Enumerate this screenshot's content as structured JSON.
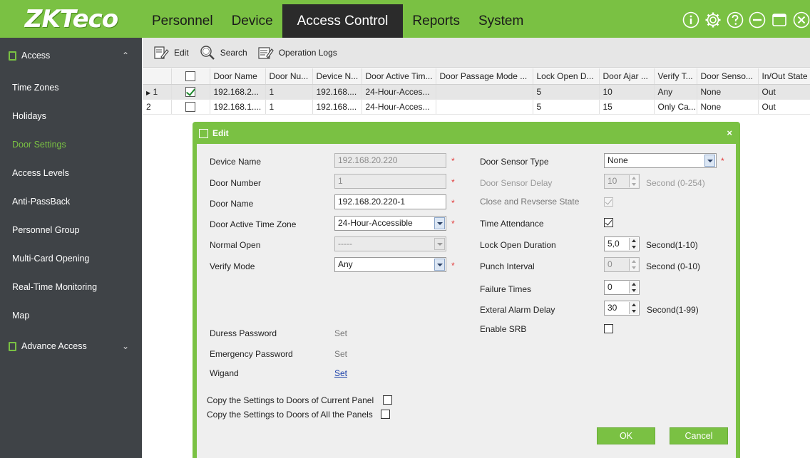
{
  "app": {
    "logo": "ZKTeco"
  },
  "nav": {
    "items": [
      {
        "label": "Personnel"
      },
      {
        "label": "Device"
      },
      {
        "label": "Access Control"
      },
      {
        "label": "Reports"
      },
      {
        "label": "System"
      }
    ],
    "active": "Access Control"
  },
  "window_icons": [
    "info-icon",
    "gear-icon",
    "help-icon",
    "minimize-icon",
    "maximize-icon",
    "close-icon"
  ],
  "sidebar": {
    "section1": "Access",
    "items": [
      "Time Zones",
      "Holidays",
      "Door Settings",
      "Access Levels",
      "Anti-PassBack",
      "Personnel Group",
      "Multi-Card Opening",
      "Real-Time Monitoring",
      "Map"
    ],
    "active": "Door Settings",
    "section2": "Advance Access"
  },
  "toolbar": {
    "edit": "Edit",
    "search": "Search",
    "operation_logs": "Operation Logs"
  },
  "grid": {
    "columns": [
      "Door Name",
      "Door Nu...",
      "Device N...",
      "Door Active Tim...",
      "Door Passage Mode ...",
      "Lock Open D...",
      "Door Ajar ...",
      "Verify T...",
      "Door Senso...",
      "In/Out State"
    ],
    "rows": [
      {
        "index": "1",
        "checked": true,
        "cells": [
          "192.168.2...",
          "1",
          "192.168....",
          "24-Hour-Acces...",
          "",
          "5",
          "10",
          "Any",
          "None",
          "Out"
        ]
      },
      {
        "index": "2",
        "checked": false,
        "cells": [
          "192.168.1....",
          "1",
          "192.168....",
          "24-Hour-Acces...",
          "",
          "5",
          "15",
          "Only Ca...",
          "None",
          "Out"
        ]
      }
    ]
  },
  "dialog": {
    "title": "Edit",
    "close": "×",
    "left": {
      "device_name": {
        "label": "Device Name",
        "value": "192.168.20.220"
      },
      "door_number": {
        "label": "Door Number",
        "value": "1"
      },
      "door_name": {
        "label": "Door Name",
        "value": "192.168.20.220-1"
      },
      "door_active_tz": {
        "label": "Door Active Time Zone",
        "value": "24-Hour-Accessible"
      },
      "normal_open": {
        "label": "Normal Open",
        "value": "-----"
      },
      "verify_mode": {
        "label": "Verify Mode",
        "value": "Any"
      },
      "duress_password": {
        "label": "Duress Password",
        "value": "Set"
      },
      "emergency_password": {
        "label": "Emergency Password",
        "value": "Set"
      },
      "wigand": {
        "label": "Wigand",
        "value": "Set"
      }
    },
    "right": {
      "door_sensor_type": {
        "label": "Door Sensor Type",
        "value": "None"
      },
      "door_sensor_delay": {
        "label": "Door Sensor Delay",
        "value": "10",
        "unit": "Second (0-254)"
      },
      "close_reverse": {
        "label": "Close and Revserse State"
      },
      "time_attendance": {
        "label": "Time Attendance"
      },
      "lock_open_duration": {
        "label": "Lock Open Duration",
        "value": "5,0",
        "unit": "Second(1-10)"
      },
      "punch_interval": {
        "label": "Punch Interval",
        "value": "0",
        "unit": "Second (0-10)"
      },
      "failure_times": {
        "label": "Failure Times",
        "value": "0"
      },
      "ext_alarm_delay": {
        "label": "Exteral Alarm Delay",
        "value": "30",
        "unit": "Second(1-99)"
      },
      "enable_srb": {
        "label": "Enable SRB"
      }
    },
    "copy_current": "Copy the Settings to Doors of Current Panel",
    "copy_all": "Copy the Settings to Doors of All the Panels",
    "required_mark": "*",
    "ok": "OK",
    "cancel": "Cancel"
  },
  "colors": {
    "brand": "#7ac143",
    "sidebar": "#3f4347",
    "nav_active": "#2b2b2b",
    "required": "#e23b3b"
  }
}
